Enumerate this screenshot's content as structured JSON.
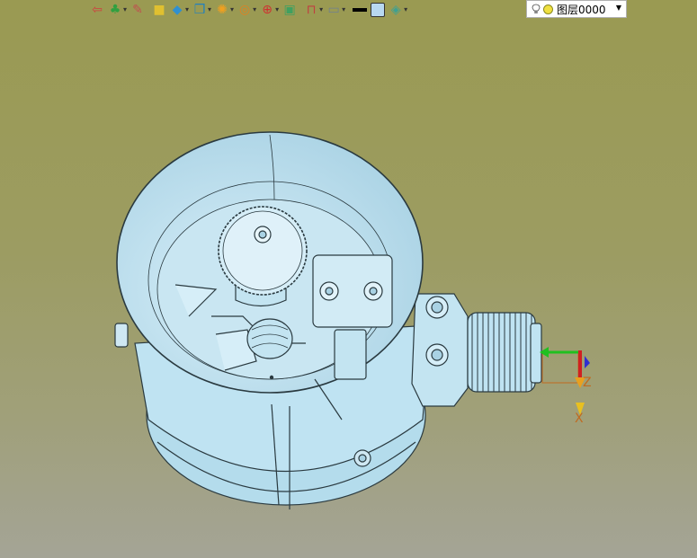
{
  "toolbar": {
    "buttons": [
      {
        "name": "exit-sketch-button",
        "icon": "exit-icon",
        "color": "#d04040",
        "dropdown": false
      },
      {
        "name": "insert-component-button",
        "icon": "tree-icon",
        "color": "#30a040",
        "dropdown": true
      },
      {
        "name": "pencil-button",
        "icon": "pencil-icon",
        "color": "#c05050",
        "dropdown": false
      },
      {
        "name": "block-button",
        "icon": "block-icon",
        "color": "#e0c030",
        "dropdown": false
      },
      {
        "name": "solid-button",
        "icon": "cube-icon",
        "color": "#3090d0",
        "dropdown": true
      },
      {
        "name": "view-orient-button",
        "icon": "view-cube-icon",
        "color": "#2080c0",
        "dropdown": true
      },
      {
        "name": "render-mode-button",
        "icon": "render-icon",
        "color": "#f0a020",
        "dropdown": true
      },
      {
        "name": "zoom-button",
        "icon": "zoom-icon",
        "color": "#e08020",
        "dropdown": true
      },
      {
        "name": "origin-button",
        "icon": "origin-icon",
        "color": "#d03030",
        "dropdown": true
      },
      {
        "name": "image-button",
        "icon": "image-icon",
        "color": "#40a060",
        "dropdown": false
      },
      {
        "name": "section-button",
        "icon": "section-icon",
        "color": "#c04040",
        "dropdown": true
      },
      {
        "name": "display-button",
        "icon": "monitor-icon",
        "color": "#708090",
        "dropdown": true
      },
      {
        "name": "line-color-button",
        "icon": "line-icon",
        "color": "#000000",
        "dropdown": false
      },
      {
        "name": "fill-color-button",
        "icon": "fill-icon",
        "color": "#b8d8f0",
        "dropdown": false
      },
      {
        "name": "layer-tool-button",
        "icon": "layers-icon",
        "color": "#40a090",
        "dropdown": true
      }
    ]
  },
  "layer": {
    "label": "图层0000",
    "bulb_icon": "lightbulb-icon",
    "dot_color": "#f0e040"
  },
  "viewport": {
    "model_color": "#bfe3f2",
    "edge_color": "#2a3a40",
    "axes": {
      "z_label": "Z",
      "x_label": "X",
      "label_color": "#c06a20"
    }
  }
}
